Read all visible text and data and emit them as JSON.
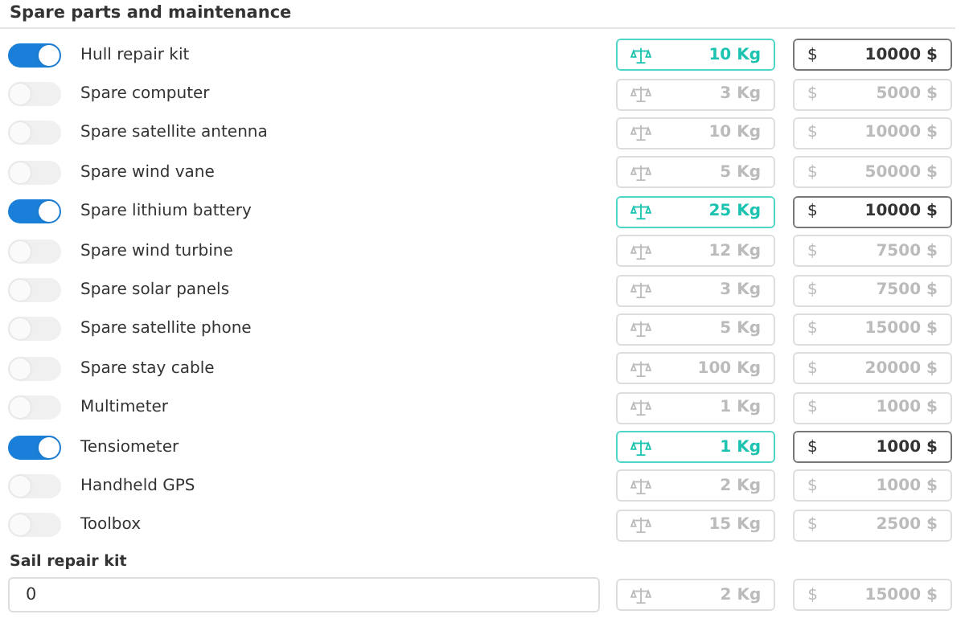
{
  "section_title": "Spare parts and maintenance",
  "items": [
    {
      "name": "Hull repair kit",
      "on": true,
      "weight": "10 Kg",
      "price": "10000 $"
    },
    {
      "name": "Spare computer",
      "on": false,
      "weight": "3 Kg",
      "price": "5000 $"
    },
    {
      "name": "Spare satellite antenna",
      "on": false,
      "weight": "10 Kg",
      "price": "10000 $"
    },
    {
      "name": "Spare wind vane",
      "on": false,
      "weight": "5 Kg",
      "price": "50000 $"
    },
    {
      "name": "Spare lithium battery",
      "on": true,
      "weight": "25 Kg",
      "price": "10000 $"
    },
    {
      "name": "Spare wind turbine",
      "on": false,
      "weight": "12 Kg",
      "price": "7500 $"
    },
    {
      "name": "Spare solar panels",
      "on": false,
      "weight": "3 Kg",
      "price": "7500 $"
    },
    {
      "name": "Spare satellite phone",
      "on": false,
      "weight": "5 Kg",
      "price": "15000 $"
    },
    {
      "name": "Spare stay cable",
      "on": false,
      "weight": "100 Kg",
      "price": "20000 $"
    },
    {
      "name": "Multimeter",
      "on": false,
      "weight": "1 Kg",
      "price": "1000 $"
    },
    {
      "name": "Tensiometer",
      "on": true,
      "weight": "1 Kg",
      "price": "1000 $"
    },
    {
      "name": "Handheld GPS",
      "on": false,
      "weight": "2 Kg",
      "price": "1000 $"
    },
    {
      "name": "Toolbox",
      "on": false,
      "weight": "15 Kg",
      "price": "2500 $"
    }
  ],
  "sail_repair": {
    "label": "Sail repair kit",
    "value": "0",
    "weight": "2 Kg",
    "price": "15000 $",
    "currency": "$"
  },
  "currency": "$"
}
